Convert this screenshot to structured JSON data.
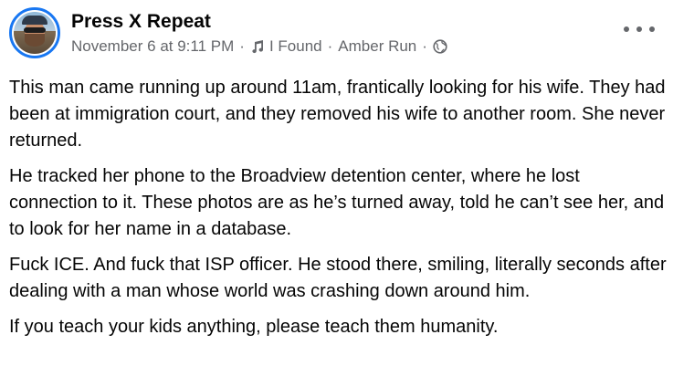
{
  "post": {
    "author": "Press X Repeat",
    "timestamp": "November 6 at 9:11 PM",
    "separator": "·",
    "music": {
      "icon": "music-note-icon",
      "song": "I Found",
      "artist": "Amber Run"
    },
    "privacy_icon": "globe-icon",
    "more_icon": "more-options-icon",
    "paragraphs": [
      "This man came running up around 11am, frantically looking for his wife. They had been at immigration court, and they removed his wife to another room. She never returned.",
      "He tracked her phone to the Broadview detention center, where he lost connection to it. These photos are as he’s turned away, told he can’t see her, and to look for her name in a database.",
      "Fuck ICE. And fuck that ISP officer. He stood there, smiling, literally seconds after dealing with a man whose world was crashing down around him.",
      "If you teach your kids anything, please teach them humanity."
    ]
  },
  "colors": {
    "avatar_ring": "#1877f2",
    "text_primary": "#050505",
    "text_secondary": "#65676b"
  }
}
